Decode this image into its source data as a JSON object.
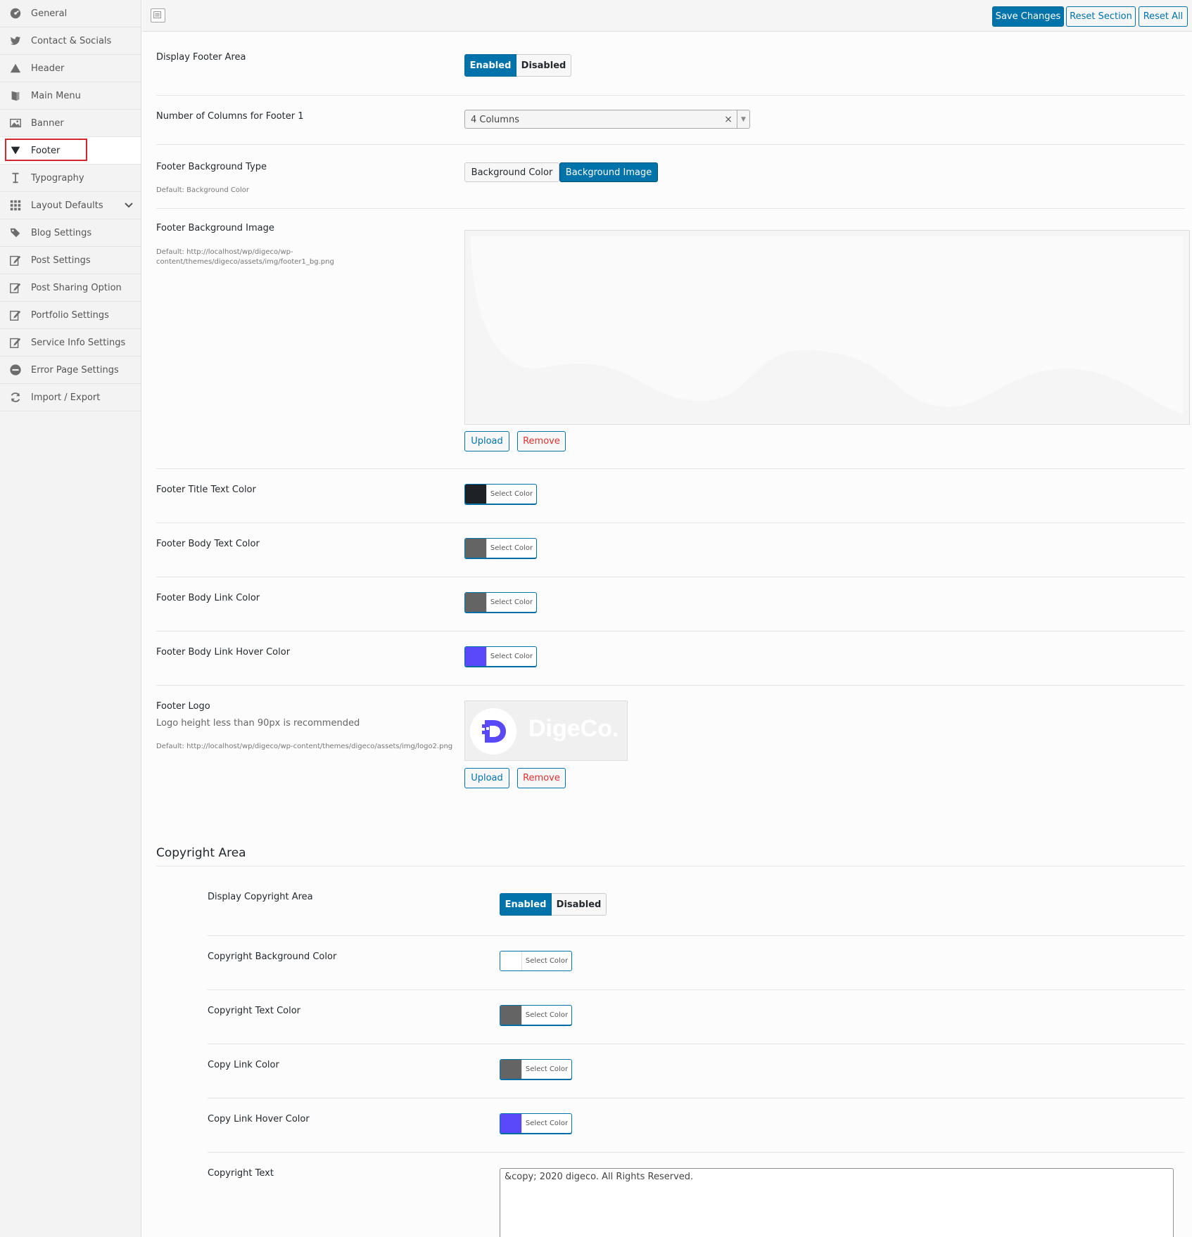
{
  "sidebar": {
    "items": [
      {
        "label": "General",
        "icon": "dashboard-icon"
      },
      {
        "label": "Contact & Socials",
        "icon": "twitter-icon"
      },
      {
        "label": "Header",
        "icon": "triangle-icon"
      },
      {
        "label": "Main Menu",
        "icon": "menu-icon"
      },
      {
        "label": "Banner",
        "icon": "image-icon"
      },
      {
        "label": "Footer",
        "icon": "arrow-down-icon"
      },
      {
        "label": "Typography",
        "icon": "text-icon"
      },
      {
        "label": "Layout Defaults",
        "icon": "grid-icon"
      },
      {
        "label": "Blog Settings",
        "icon": "tags-icon"
      },
      {
        "label": "Post Settings",
        "icon": "edit-icon"
      },
      {
        "label": "Post Sharing Option",
        "icon": "edit-icon"
      },
      {
        "label": "Portfolio Settings",
        "icon": "edit-icon"
      },
      {
        "label": "Service Info Settings",
        "icon": "edit-icon"
      },
      {
        "label": "Error Page Settings",
        "icon": "minus-circle-icon"
      },
      {
        "label": "Import / Export",
        "icon": "refresh-icon"
      }
    ],
    "active": "Footer"
  },
  "topbar": {
    "save_label": "Save Changes",
    "reset_section_label": "Reset Section",
    "reset_all_label": "Reset All"
  },
  "footer": {
    "display_area": {
      "label": "Display Footer Area",
      "enabled": "Enabled",
      "disabled": "Disabled",
      "value": "Enabled"
    },
    "columns": {
      "label": "Number of Columns for Footer 1",
      "value": "4 Columns",
      "clear": "×",
      "arrow": "▼"
    },
    "bg_type": {
      "label": "Footer Background Type",
      "desc": "Default: Background Color",
      "opt1": "Background Color",
      "opt2": "Background Image",
      "value": "Background Image"
    },
    "bg_image": {
      "label": "Footer Background Image",
      "desc": "Default: http://localhost/wp/digeco/wp-content/themes/digeco/assets/img/footer1_bg.png",
      "upload": "Upload",
      "remove": "Remove"
    },
    "title_color": {
      "label": "Footer Title Text Color",
      "button": "Select Color",
      "color": "#1e2125"
    },
    "body_color": {
      "label": "Footer Body Text Color",
      "button": "Select Color",
      "color": "#646464"
    },
    "link_color": {
      "label": "Footer Body Link Color",
      "button": "Select Color",
      "color": "#646464"
    },
    "link_hover_color": {
      "label": "Footer Body Link Hover Color",
      "button": "Select Color",
      "color": "#5a49f8"
    },
    "logo": {
      "label": "Footer Logo",
      "sub": "Logo height less than 90px is recommended",
      "desc": "Default: http://localhost/wp/digeco/wp-content/themes/digeco/assets/img/logo2.png",
      "logo_text": "DigeCo.",
      "upload": "Upload",
      "remove": "Remove"
    }
  },
  "copyright": {
    "section_title": "Copyright Area",
    "display_area": {
      "label": "Display Copyright Area",
      "enabled": "Enabled",
      "disabled": "Disabled",
      "value": "Enabled"
    },
    "bg_color": {
      "label": "Copyright Background Color",
      "button": "Select Color",
      "color": "#ffffff"
    },
    "text_color": {
      "label": "Copyright Text Color",
      "button": "Select Color",
      "color": "#646464"
    },
    "link_color": {
      "label": "Copy Link Color",
      "button": "Select Color",
      "color": "#646464"
    },
    "link_hover_color": {
      "label": "Copy Link Hover Color",
      "button": "Select Color",
      "color": "#5a49f8"
    },
    "text": {
      "label": "Copyright Text",
      "value": "&copy; 2020 digeco. All Rights Reserved."
    }
  },
  "colors": {
    "accent": "#0073aa",
    "active_border": "#d22630"
  }
}
